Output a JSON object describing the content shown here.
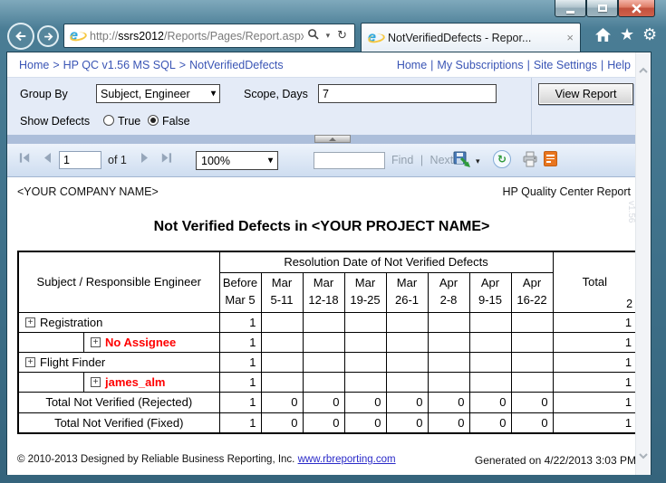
{
  "browser": {
    "url_parts": {
      "scheme": "http://",
      "host": "ssrs2012",
      "path": "/Reports/Pages/Report.aspx?ItemF"
    },
    "tab_title": "NotVerifiedDefects - Repor..."
  },
  "breadcrumb": {
    "links": [
      "Home",
      "HP QC v1.56 MS SQL",
      "NotVerifiedDefects"
    ],
    "separator": ">"
  },
  "site_links": {
    "items": [
      "Home",
      "My Subscriptions",
      "Site Settings",
      "Help"
    ],
    "separator": "|"
  },
  "parameters": {
    "group_by_label": "Group By",
    "group_by_value": "Subject, Engineer",
    "scope_label": "Scope, Days",
    "scope_value": "7",
    "show_defects_label": "Show Defects",
    "option_true": "True",
    "option_false": "False",
    "selected_option": "False",
    "view_report_label": "View Report"
  },
  "toolbar": {
    "page_value": "1",
    "pages_label": "of 1",
    "zoom_value": "100%",
    "find_value": "",
    "find_label": "Find",
    "next_label": "Next"
  },
  "report": {
    "company": "<YOUR COMPANY NAME>",
    "report_type": "HP Quality Center Report",
    "title": "Not Verified Defects in <YOUR PROJECT NAME>",
    "version_watermark": "v1.56",
    "footer_copyright": "© 2010-2013 Designed by Reliable Business Reporting, Inc.",
    "footer_link": "www.rbreporting.com",
    "generated": "Generated on 4/22/2013 3:03 PM"
  },
  "table": {
    "corner_header": "Subject / Responsible Engineer",
    "group_header": "Resolution Date of Not Verified Defects",
    "total_header": "Total",
    "total_header_value": "2",
    "columns": [
      [
        "Before",
        "Mar 5"
      ],
      [
        "Mar",
        "5-11"
      ],
      [
        "Mar",
        "12-18"
      ],
      [
        "Mar",
        "19-25"
      ],
      [
        "Mar",
        "26-1"
      ],
      [
        "Apr",
        "2-8"
      ],
      [
        "Apr",
        "9-15"
      ],
      [
        "Apr",
        "16-22"
      ]
    ],
    "rows": [
      {
        "label": "Registration",
        "indent": 0,
        "style": "black",
        "values": [
          "1",
          "",
          "",
          "",
          "",
          "",
          "",
          ""
        ],
        "total": "1"
      },
      {
        "label": "No Assignee",
        "indent": 1,
        "style": "red",
        "values": [
          "1",
          "",
          "",
          "",
          "",
          "",
          "",
          ""
        ],
        "total": "1"
      },
      {
        "label": "Flight Finder",
        "indent": 0,
        "style": "black",
        "values": [
          "1",
          "",
          "",
          "",
          "",
          "",
          "",
          ""
        ],
        "total": "1"
      },
      {
        "label": "james_alm",
        "indent": 1,
        "style": "red",
        "values": [
          "1",
          "",
          "",
          "",
          "",
          "",
          "",
          ""
        ],
        "total": "1"
      },
      {
        "label": "Total Not Verified (Rejected)",
        "indent": 0,
        "style": "total",
        "values": [
          "1",
          "0",
          "0",
          "0",
          "0",
          "0",
          "0",
          "0"
        ],
        "total": "1"
      },
      {
        "label": "Total Not Verified (Fixed)",
        "indent": 0,
        "style": "total",
        "values": [
          "1",
          "0",
          "0",
          "0",
          "0",
          "0",
          "0",
          "0"
        ],
        "total": "1"
      }
    ]
  },
  "icons": {
    "plus": "+",
    "caret": "▾",
    "close": "×",
    "star": "★",
    "gear": "⚙",
    "refresh": "↻",
    "pipe": "|"
  },
  "colors": {
    "alert_red": "#FF0000",
    "link_blue": "#3A55B5",
    "frame_teal": "#3E7089"
  }
}
